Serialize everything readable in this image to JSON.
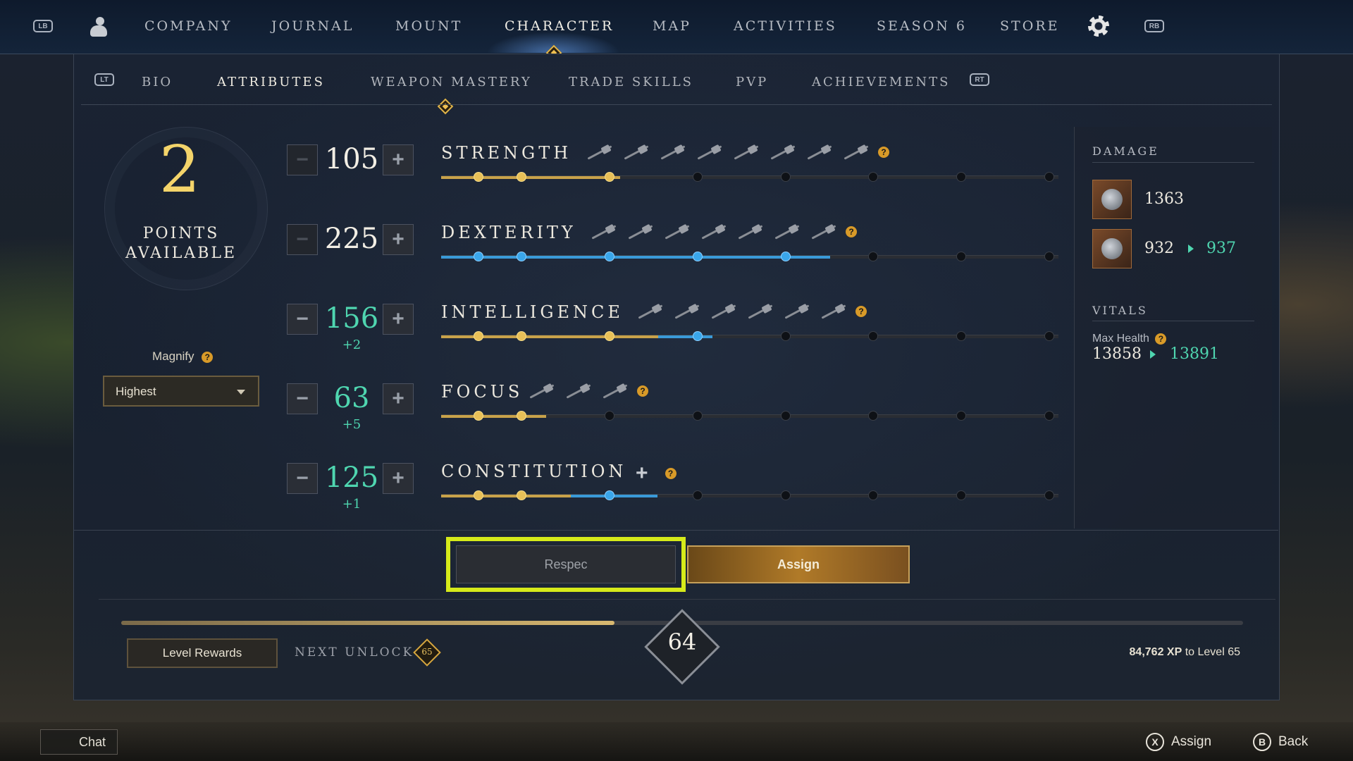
{
  "topnav": {
    "lb": "LB",
    "rb": "RB",
    "items": [
      "COMPANY",
      "JOURNAL",
      "MOUNT",
      "CHARACTER",
      "MAP",
      "ACTIVITIES",
      "SEASON 6",
      "STORE"
    ],
    "active": "CHARACTER"
  },
  "subnav": {
    "lt": "LT",
    "rt": "RT",
    "items": [
      "BIO",
      "ATTRIBUTES",
      "WEAPON MASTERY",
      "TRADE SKILLS",
      "PVP",
      "ACHIEVEMENTS"
    ],
    "active": "ATTRIBUTES"
  },
  "points": {
    "value": "2",
    "label_line1": "POINTS",
    "label_line2": "AVAILABLE"
  },
  "magnify": {
    "label": "Magnify",
    "help": "?",
    "selected": "Highest"
  },
  "attributes": [
    {
      "name": "STRENGTH",
      "value": "105",
      "bonus": "",
      "increased": false,
      "minus_enabled": false,
      "weapon_icons": 8,
      "help": "?",
      "progress": 0.29,
      "color": "gold",
      "nodes_gold": 3,
      "nodes_blue": 0
    },
    {
      "name": "DEXTERITY",
      "value": "225",
      "bonus": "",
      "increased": false,
      "minus_enabled": false,
      "weapon_icons": 7,
      "help": "?",
      "progress": 0.63,
      "color": "blue",
      "nodes_gold": 0,
      "nodes_blue": 5
    },
    {
      "name": "INTELLIGENCE",
      "value": "156",
      "bonus": "+2",
      "increased": true,
      "minus_enabled": true,
      "weapon_icons": 6,
      "help": "?",
      "progress": 0.44,
      "color": "mixed",
      "nodes_gold": 3,
      "nodes_blue": 1
    },
    {
      "name": "FOCUS",
      "value": "63",
      "bonus": "+5",
      "increased": true,
      "minus_enabled": true,
      "weapon_icons": 3,
      "help": "?",
      "progress": 0.17,
      "color": "gold",
      "nodes_gold": 2,
      "nodes_blue": 0
    },
    {
      "name": "CONSTITUTION",
      "value": "125",
      "bonus": "+1",
      "increased": true,
      "minus_enabled": true,
      "weapon_icons": 0,
      "help": "?",
      "progress": 0.35,
      "color": "mixed",
      "nodes_gold": 2,
      "nodes_blue": 1
    }
  ],
  "stats": {
    "damage_title": "DAMAGE",
    "damage": [
      {
        "icon": "weapon-1-icon",
        "value": "1363",
        "new_value": ""
      },
      {
        "icon": "weapon-2-icon",
        "value": "932",
        "new_value": "937"
      }
    ],
    "vitals_title": "VITALS",
    "max_health_label": "Max Health",
    "max_health": "13858",
    "max_health_new": "13891"
  },
  "buttons": {
    "respec": "Respec",
    "assign": "Assign"
  },
  "level": {
    "rewards_label": "Level Rewards",
    "next_unlock_label": "NEXT UNLOCK",
    "next_unlock_level": "65",
    "current": "64",
    "xp_progress": 0.44,
    "xp_amount": "84,762 XP",
    "xp_suffix": " to Level 65"
  },
  "hud": {
    "chat": "Chat",
    "hints": [
      {
        "key": "X",
        "label": "Assign"
      },
      {
        "key": "B",
        "label": "Back"
      }
    ]
  },
  "colors": {
    "accent_gold": "#e8c058",
    "accent_blue": "#3aa6ea",
    "increase_green": "#4fd6b0",
    "highlight": "#d6ea1a"
  }
}
